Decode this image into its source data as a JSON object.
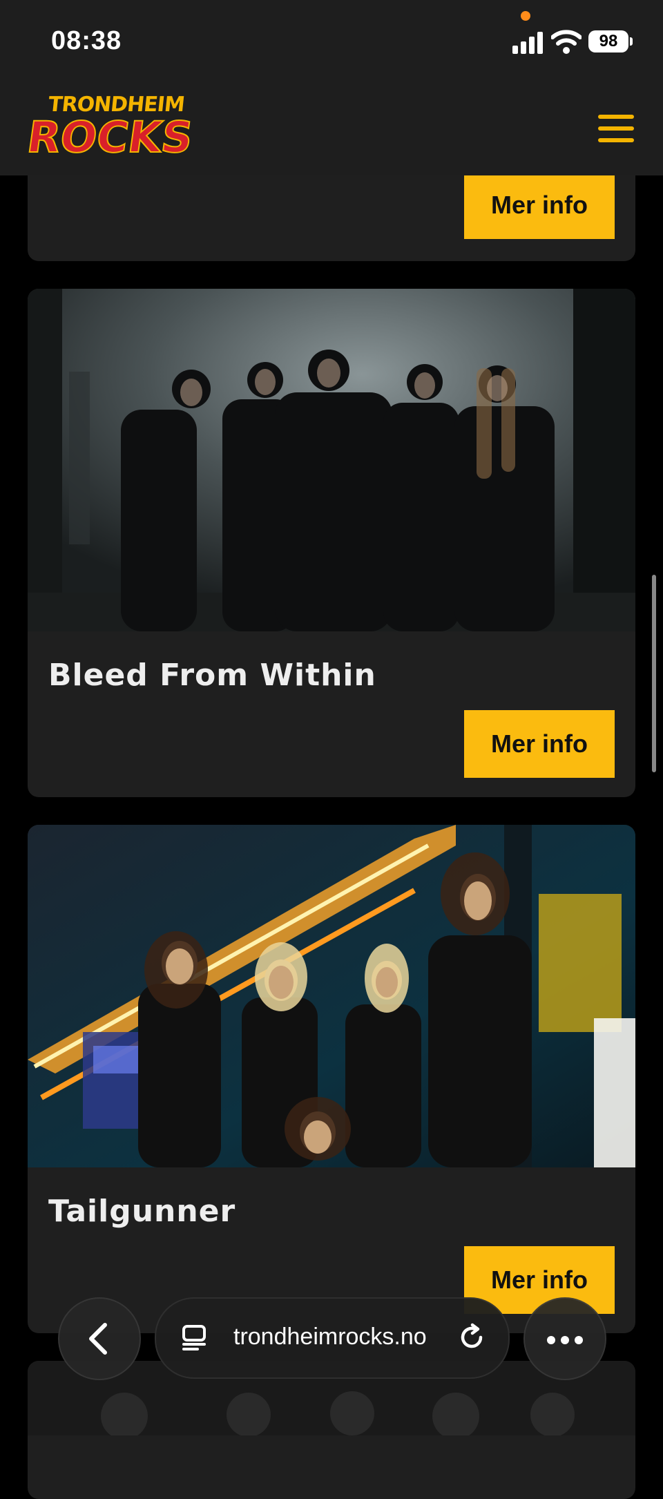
{
  "status_bar": {
    "time": "08:38",
    "battery": "98"
  },
  "header": {
    "logo_top": "TRONDHEIM",
    "logo_main": "ROCKS"
  },
  "cards": [
    {
      "title": "",
      "button": "Mer info"
    },
    {
      "title": "Bleed From Within",
      "button": "Mer info"
    },
    {
      "title": "Tailgunner",
      "button": "Mer info"
    }
  ],
  "browser": {
    "url": "trondheimrocks.no"
  },
  "colors": {
    "accent": "#fbbb0f",
    "logo_red": "#d9202a",
    "card_bg": "#1f1f1f",
    "page_bg": "#000000"
  },
  "icons": [
    "hamburger-menu-icon",
    "back-arrow-icon",
    "tabs-icon",
    "reload-icon",
    "more-icon",
    "signal-icon",
    "wifi-icon",
    "battery-icon"
  ]
}
